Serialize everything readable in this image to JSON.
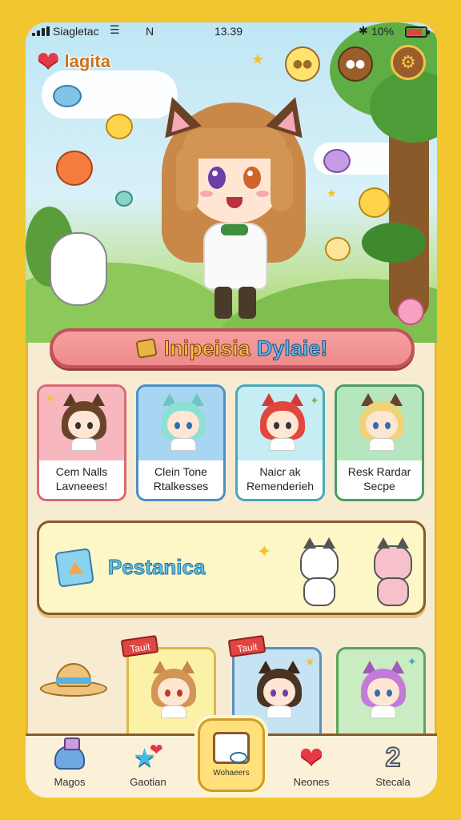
{
  "status_bar": {
    "carrier": "Siagletac",
    "wifi_label": "N",
    "time": "13.39",
    "battery_pct": "10%"
  },
  "player": {
    "name": "lagita"
  },
  "event_banner": {
    "word1": "Inipeisia",
    "word2": "Dylaie!"
  },
  "characters": [
    {
      "line1": "Cem Nalls",
      "line2": "Lavneees!",
      "theme": "#f2a0a8"
    },
    {
      "line1": "Clein Tone",
      "line2": "Rtalkesses",
      "theme": "#8cc7ec"
    },
    {
      "line1": "Naicr ak",
      "line2": "Remenderieh",
      "theme": "#8fd6d0"
    },
    {
      "line1": "Resk Rardar",
      "line2": "Secpe",
      "theme": "#8ad1a0"
    }
  ],
  "shop_banner": {
    "title": "Pestanica"
  },
  "tags": [
    "Tauit",
    "Tauit"
  ],
  "bottom_nav": [
    {
      "label": "Magos",
      "icon": "slime-icon"
    },
    {
      "label": "Gaotian",
      "icon": "star-icon"
    },
    {
      "label": "Wohaeers",
      "icon": "board-icon"
    },
    {
      "label": "Neones",
      "icon": "heart-icon"
    },
    {
      "label": "Stecala",
      "icon": "number-two-icon"
    }
  ],
  "colors": {
    "background": "#f2c62e",
    "accent_pink": "#ef8a8a",
    "accent_blue": "#5cc3e8",
    "border_brown": "#8a5a2a"
  }
}
